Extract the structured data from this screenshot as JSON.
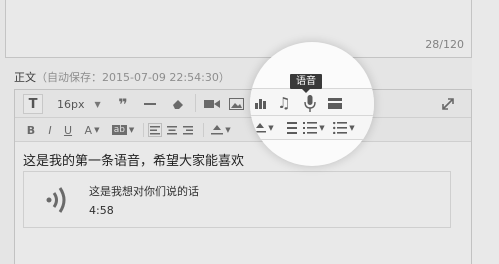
{
  "counter": "28/120",
  "body_label": {
    "label": "正文",
    "autosave": "（自动保存：2015-07-09 22:54:30）"
  },
  "toolbar": {
    "text_style_glyph": "T",
    "font_size": "16px",
    "tooltip": "语音",
    "icons": [
      "text-style-icon",
      "quote-icon",
      "horizontal-rule-icon",
      "eraser-icon",
      "video-icon",
      "image-icon",
      "chart-icon",
      "music-icon",
      "microphone-icon",
      "card-icon",
      "fullscreen-icon"
    ],
    "format_glyphs": {
      "bold": "B",
      "italic": "I",
      "underline": "U",
      "color": "A",
      "bg": "ab"
    }
  },
  "content": {
    "line": "这是我的第一条语音，希望大家能喜欢",
    "voice": {
      "title": "这是我想对你们说的话",
      "duration": "4:58"
    }
  },
  "colors": {
    "dim": "#e5e5e5",
    "spotlight": "#fbfbfb",
    "tooltip_bg": "#3a3a3a"
  }
}
